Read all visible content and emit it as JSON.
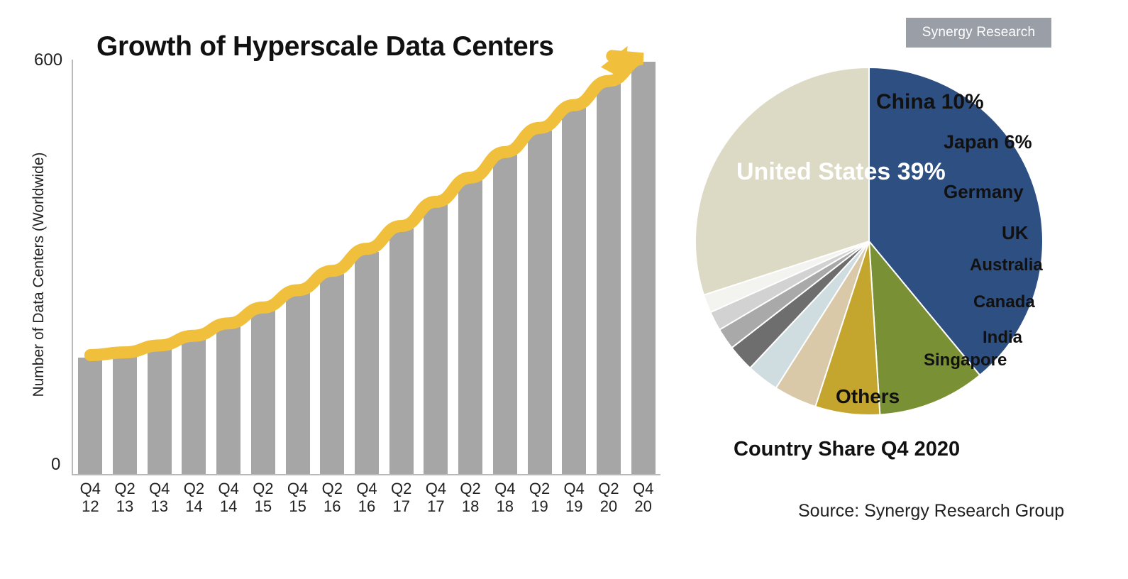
{
  "watermark": {
    "label": "Synergy Research"
  },
  "bar_panel": {
    "title": "Growth of Hyperscale Data Centers",
    "y_axis_label": "Number of Data Centers (Worldwide)",
    "y_tick_top": "600",
    "y_tick_bottom": "0"
  },
  "pie_panel": {
    "caption": "Country Share Q4 2020",
    "source": "Source: Synergy Research Group",
    "labels": {
      "united_states": "United States",
      "united_states_pct": "39%",
      "china": "China",
      "china_pct": "10%",
      "japan": "Japan",
      "japan_pct": "6%",
      "germany": "Germany",
      "uk": "UK",
      "australia": "Australia",
      "canada": "Canada",
      "india": "India",
      "singapore": "Singapore",
      "others": "Others"
    }
  },
  "chart_data": [
    {
      "type": "bar",
      "title": "Growth of Hyperscale Data Centers",
      "xlabel": "",
      "ylabel": "Number of Data Centers (Worldwide)",
      "ylim": [
        0,
        600
      ],
      "yticks": [
        0,
        600
      ],
      "grid": false,
      "legend": "none",
      "bar_color": "#a6a6a6",
      "annotation": {
        "type": "trend-arrow",
        "color": "#f0c03c",
        "description": "Thick yellow upward-curving arrow overlaying the bar tops from left to right"
      },
      "categories": [
        "Q4 12",
        "Q2 13",
        "Q4 13",
        "Q2 14",
        "Q4 14",
        "Q2 15",
        "Q4 15",
        "Q2 16",
        "Q4 16",
        "Q2 17",
        "Q4 17",
        "Q2 18",
        "Q4 18",
        "Q2 19",
        "Q4 19",
        "Q2 20",
        "Q4 20"
      ],
      "category_lines": [
        [
          "Q4",
          "12"
        ],
        [
          "Q2",
          "13"
        ],
        [
          "Q4",
          "13"
        ],
        [
          "Q2",
          "14"
        ],
        [
          "Q4",
          "14"
        ],
        [
          "Q2",
          "15"
        ],
        [
          "Q4",
          "15"
        ],
        [
          "Q2",
          "16"
        ],
        [
          "Q4",
          "16"
        ],
        [
          "Q2",
          "17"
        ],
        [
          "Q4",
          "17"
        ],
        [
          "Q2",
          "18"
        ],
        [
          "Q4",
          "18"
        ],
        [
          "Q2",
          "19"
        ],
        [
          "Q4",
          "19"
        ],
        [
          "Q2",
          "20"
        ],
        [
          "Q4",
          "20"
        ]
      ],
      "values": [
        168,
        172,
        182,
        196,
        214,
        237,
        262,
        290,
        322,
        355,
        390,
        425,
        462,
        497,
        530,
        565,
        597
      ]
    },
    {
      "type": "pie",
      "title": "Country Share Q4 2020",
      "source": "Source: Synergy Research Group",
      "legend": "none",
      "labels": [
        "United States",
        "China",
        "Japan",
        "Germany",
        "UK",
        "Australia",
        "Canada",
        "India",
        "Singapore",
        "Others"
      ],
      "values": [
        39,
        10,
        6,
        4,
        3,
        2.5,
        2,
        1.8,
        1.7,
        30
      ],
      "display_percents": [
        "39%",
        "10%",
        "6%",
        "",
        "",
        "",
        "",
        "",
        "",
        ""
      ],
      "colors": [
        "#2e4f82",
        "#7a9034",
        "#c4a52e",
        "#d9c9a8",
        "#cfdde0",
        "#6e6e6e",
        "#a9a9a9",
        "#d2d2d2",
        "#f3f3f0",
        "#dcd9c4"
      ]
    }
  ]
}
